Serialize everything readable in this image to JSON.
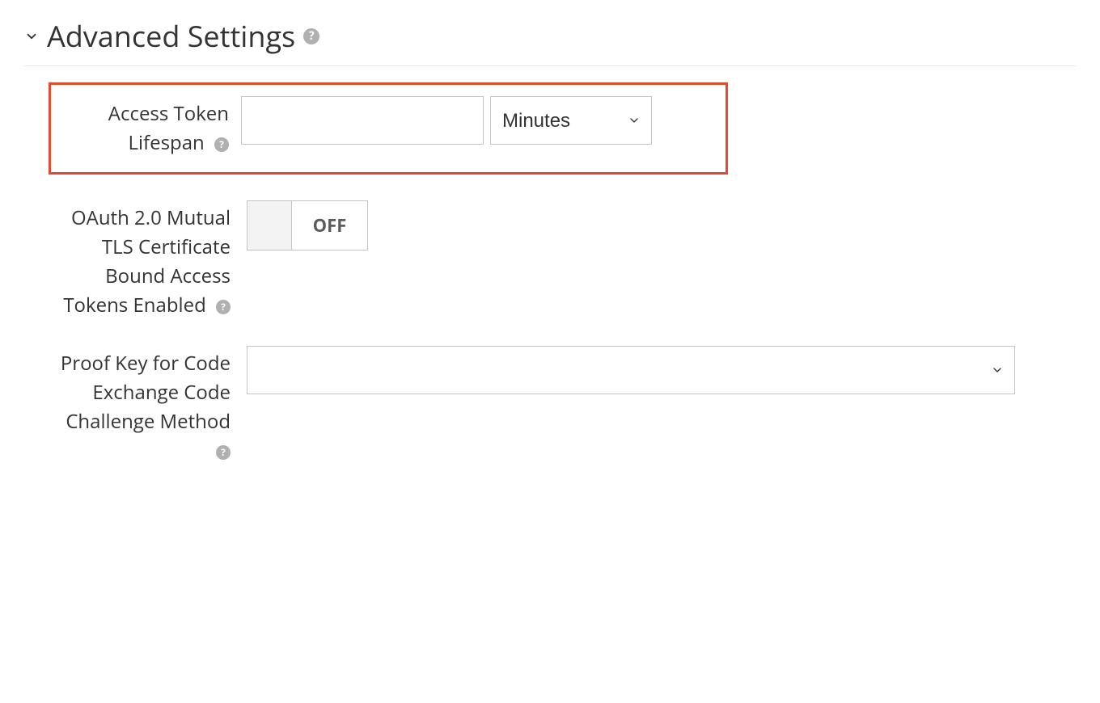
{
  "section": {
    "title": "Advanced Settings"
  },
  "fields": {
    "access_token_lifespan": {
      "label": "Access Token Lifespan",
      "value": "",
      "unit": "Minutes"
    },
    "oauth_mtls": {
      "label": "OAuth 2.0 Mutual TLS Certificate Bound Access Tokens Enabled",
      "value": "OFF"
    },
    "pkce_method": {
      "label": "Proof Key for Code Exchange Code Challenge Method",
      "value": ""
    }
  }
}
